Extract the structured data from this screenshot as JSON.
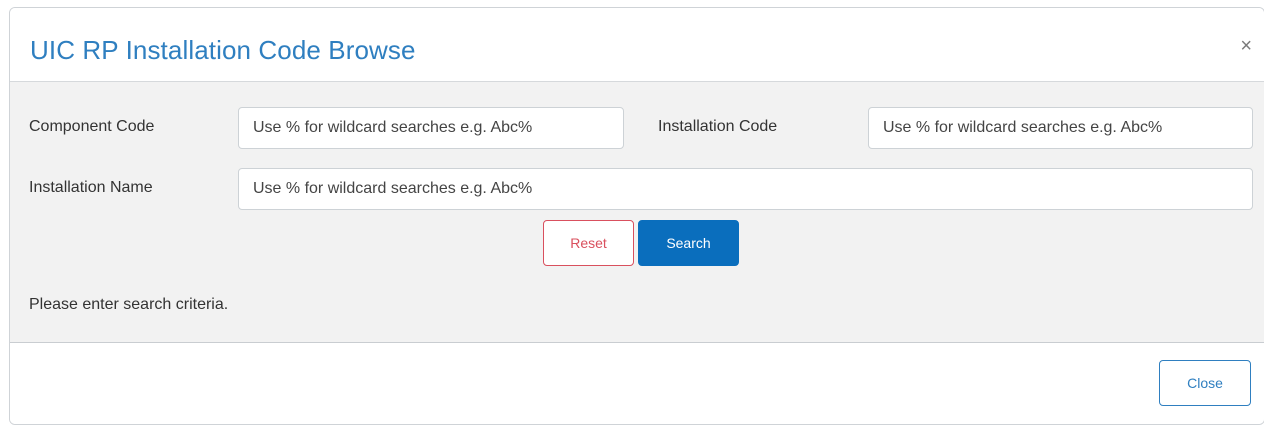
{
  "dialog": {
    "title": "UIC RP Installation Code Browse",
    "close_glyph": "×"
  },
  "form": {
    "component_code": {
      "label": "Component Code",
      "placeholder": "Use % for wildcard searches e.g. Abc%",
      "value": ""
    },
    "installation_code": {
      "label": "Installation Code",
      "placeholder": "Use % for wildcard searches e.g. Abc%",
      "value": ""
    },
    "installation_name": {
      "label": "Installation Name",
      "placeholder": "Use % for wildcard searches e.g. Abc%",
      "value": ""
    },
    "reset_label": "Reset",
    "search_label": "Search"
  },
  "status_text": "Please enter search criteria.",
  "footer": {
    "close_label": "Close"
  },
  "colors": {
    "title": "#2f7fc0",
    "search_button": "#0a6ebd",
    "reset_button": "#d9505e",
    "body_background": "#f2f2f2"
  }
}
